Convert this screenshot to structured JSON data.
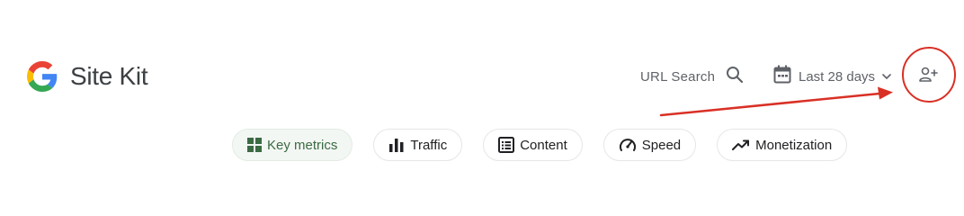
{
  "header": {
    "app_name": "Site Kit",
    "url_search_label": "URL Search",
    "date_range_label": "Last 28 days",
    "icons": {
      "logo": "google-g-logo",
      "search": "search-icon",
      "calendar": "calendar-icon",
      "dropdown": "chevron-down-icon",
      "add_user": "person-add-icon"
    }
  },
  "tabs": [
    {
      "label": "Key metrics",
      "icon": "grid-icon",
      "active": true
    },
    {
      "label": "Traffic",
      "icon": "bar-chart-icon",
      "active": false
    },
    {
      "label": "Content",
      "icon": "list-box-icon",
      "active": false
    },
    {
      "label": "Speed",
      "icon": "gauge-icon",
      "active": false
    },
    {
      "label": "Monetization",
      "icon": "trending-up-icon",
      "active": false
    }
  ],
  "colors": {
    "active_tab_text": "#3b6b43",
    "annotation_red": "#d93025",
    "text_primary": "#202124",
    "text_secondary": "#5f6368"
  }
}
